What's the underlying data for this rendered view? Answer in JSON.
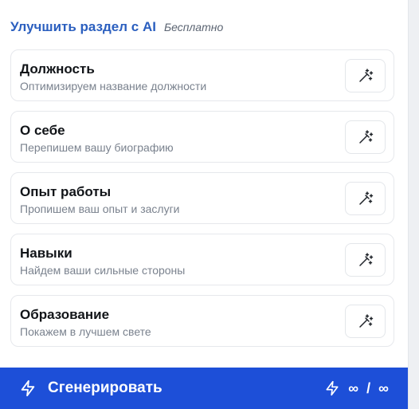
{
  "header": {
    "title": "Улучшить раздел с AI",
    "badge": "Бесплатно"
  },
  "cards": [
    {
      "name": "Должность",
      "desc": "Оптимизируем название должности",
      "icon": "magic-wand-icon"
    },
    {
      "name": "О себе",
      "desc": "Перепишем вашу биографию",
      "icon": "magic-wand-icon"
    },
    {
      "name": "Опыт работы",
      "desc": "Пропишем ваш опыт и заслуги",
      "icon": "magic-wand-icon"
    },
    {
      "name": "Навыки",
      "desc": "Найдем ваши сильные стороны",
      "icon": "magic-wand-icon"
    },
    {
      "name": "Образование",
      "desc": "Покажем в лучшем свете",
      "icon": "magic-wand-icon"
    }
  ],
  "footer": {
    "generate_label": "Сгенерировать",
    "quota_used": "∞",
    "quota_separator": "/",
    "quota_total": "∞",
    "bg_color": "#1d4fd8"
  },
  "colors": {
    "accent": "#2b5fbf"
  }
}
